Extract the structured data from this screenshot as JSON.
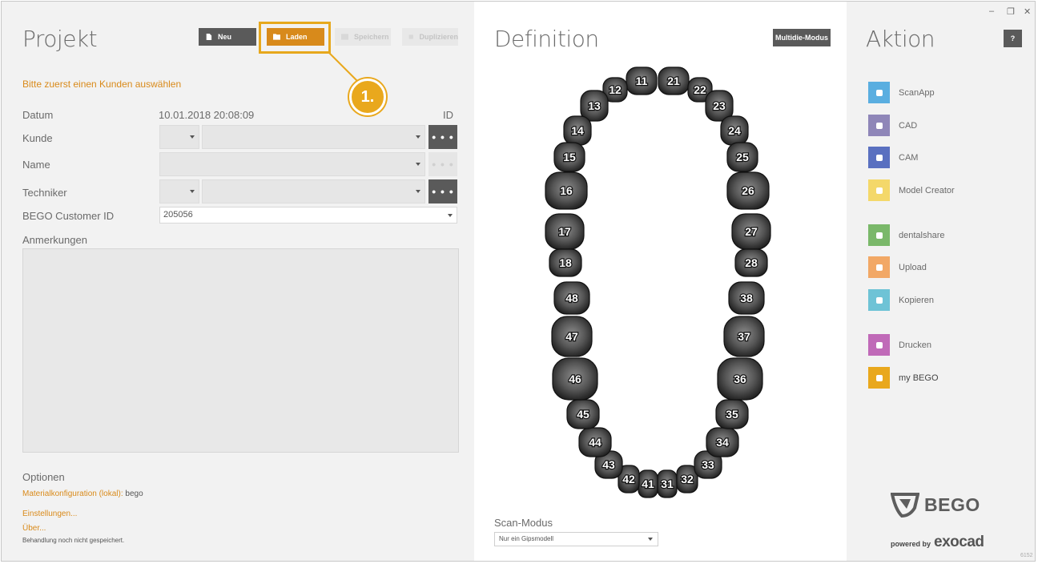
{
  "left": {
    "title": "Projekt",
    "toolbar": {
      "new": "Neu",
      "load": "Laden",
      "save": "Speichern",
      "duplicate": "Duplizieren"
    },
    "callout": "1.",
    "warning": "Bitte zuerst einen Kunden auswählen",
    "fields": {
      "date_label": "Datum",
      "date_value": "10.01.2018  20:08:09",
      "id_label": "ID",
      "customer_label": "Kunde",
      "name_label": "Name",
      "technician_label": "Techniker",
      "bego_id_label": "BEGO Customer ID",
      "bego_id_value": "205056",
      "more_glyph": "• • •"
    },
    "notes_label": "Anmerkungen",
    "options": {
      "title": "Optionen",
      "material_label": "Materialkonfiguration (lokal):",
      "material_value": "bego",
      "settings": "Einstellungen...",
      "about": "Über...",
      "status": "Behandlung noch nicht gespeichert."
    }
  },
  "middle": {
    "title": "Definition",
    "multi_button": "Multidie-Modus",
    "scan_label": "Scan-Modus",
    "scan_value": "Nur ein Gipsmodell",
    "teeth": [
      "11",
      "12",
      "13",
      "14",
      "15",
      "16",
      "17",
      "18",
      "21",
      "22",
      "23",
      "24",
      "25",
      "26",
      "27",
      "28",
      "31",
      "32",
      "33",
      "34",
      "35",
      "36",
      "37",
      "38",
      "41",
      "42",
      "43",
      "44",
      "45",
      "46",
      "47",
      "48"
    ]
  },
  "right": {
    "title": "Aktion",
    "help": "?",
    "window": {
      "min": "–",
      "restore": "❐",
      "close": "✕"
    },
    "actions": [
      {
        "label": "ScanApp",
        "color": "#5aaee0"
      },
      {
        "label": "CAD",
        "color": "#8f86b8"
      },
      {
        "label": "CAM",
        "color": "#5a70c0"
      },
      {
        "label": "Model Creator",
        "color": "#f4d86a"
      },
      {
        "label": "dentalshare",
        "color": "#7ab86a"
      },
      {
        "label": "Upload",
        "color": "#f2a866"
      },
      {
        "label": "Kopieren",
        "color": "#6ec3d6"
      },
      {
        "label": "Drucken",
        "color": "#c06ab8"
      },
      {
        "label": "my BEGO",
        "color": "#e9a81d"
      }
    ],
    "brand": "BEGO",
    "powered_by": "powered  by",
    "exocad": "exocad",
    "build": "6152"
  }
}
